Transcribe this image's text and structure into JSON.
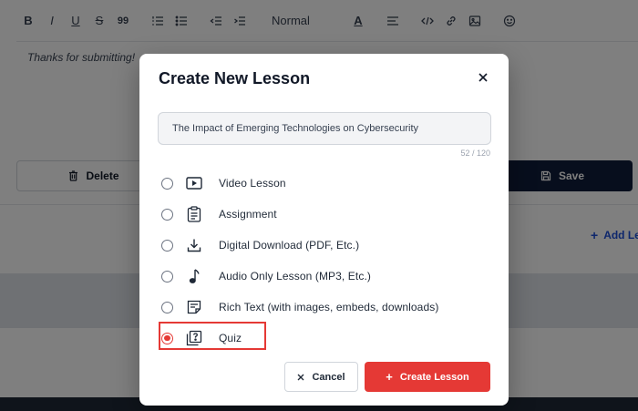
{
  "background": {
    "toolbar": {
      "bold": "B",
      "italic": "I",
      "underline": "U",
      "strike": "S",
      "quote": "99",
      "format_select": "Normal",
      "text_color_glyph": "A"
    },
    "editor_text": "Thanks for submitting!",
    "delete_label": "Delete",
    "save_label": "Save",
    "add_lesson_label": "Add Le"
  },
  "modal": {
    "title": "Create New Lesson",
    "lesson_title_value": "The Impact of Emerging Technologies on Cybersecurity",
    "char_count": "52 / 120",
    "options": [
      {
        "label": "Video Lesson",
        "icon": "video-play-icon",
        "selected": false
      },
      {
        "label": "Assignment",
        "icon": "clipboard-icon",
        "selected": false
      },
      {
        "label": "Digital Download (PDF, Etc.)",
        "icon": "download-icon",
        "selected": false
      },
      {
        "label": "Audio Only Lesson (MP3, Etc.)",
        "icon": "music-note-icon",
        "selected": false
      },
      {
        "label": "Rich Text (with images, embeds, downloads)",
        "icon": "rich-text-icon",
        "selected": false
      },
      {
        "label": "Quiz",
        "icon": "quiz-icon",
        "selected": true
      }
    ],
    "cancel_label": "Cancel",
    "create_label": "Create Lesson"
  },
  "colors": {
    "accent": "#e53935",
    "save_button": "#0f1d3a",
    "link": "#1d4ed8"
  }
}
